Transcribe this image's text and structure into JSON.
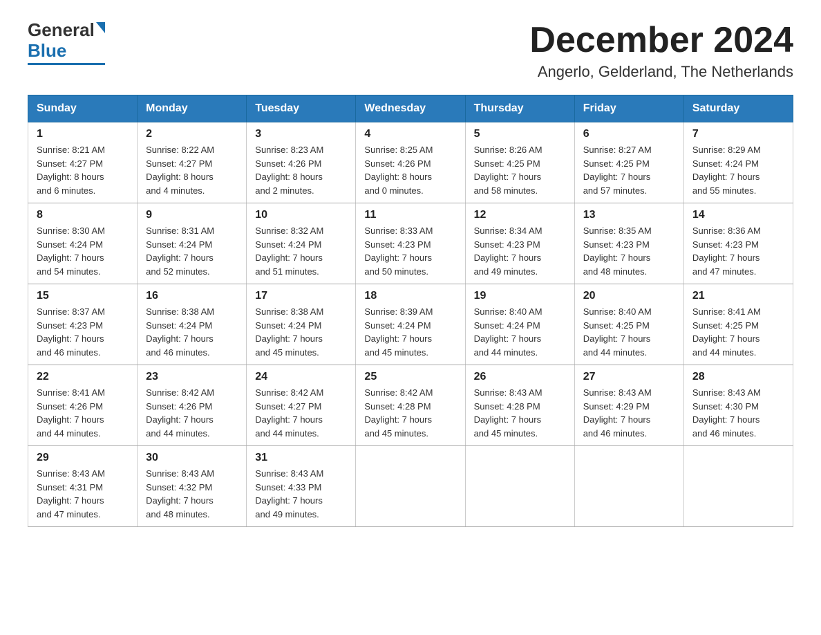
{
  "logo": {
    "text_general": "General",
    "text_blue": "Blue"
  },
  "title": "December 2024",
  "subtitle": "Angerlo, Gelderland, The Netherlands",
  "days_of_week": [
    "Sunday",
    "Monday",
    "Tuesday",
    "Wednesday",
    "Thursday",
    "Friday",
    "Saturday"
  ],
  "weeks": [
    [
      {
        "day": "1",
        "sunrise": "8:21 AM",
        "sunset": "4:27 PM",
        "daylight": "8 hours and 6 minutes."
      },
      {
        "day": "2",
        "sunrise": "8:22 AM",
        "sunset": "4:27 PM",
        "daylight": "8 hours and 4 minutes."
      },
      {
        "day": "3",
        "sunrise": "8:23 AM",
        "sunset": "4:26 PM",
        "daylight": "8 hours and 2 minutes."
      },
      {
        "day": "4",
        "sunrise": "8:25 AM",
        "sunset": "4:26 PM",
        "daylight": "8 hours and 0 minutes."
      },
      {
        "day": "5",
        "sunrise": "8:26 AM",
        "sunset": "4:25 PM",
        "daylight": "7 hours and 58 minutes."
      },
      {
        "day": "6",
        "sunrise": "8:27 AM",
        "sunset": "4:25 PM",
        "daylight": "7 hours and 57 minutes."
      },
      {
        "day": "7",
        "sunrise": "8:29 AM",
        "sunset": "4:24 PM",
        "daylight": "7 hours and 55 minutes."
      }
    ],
    [
      {
        "day": "8",
        "sunrise": "8:30 AM",
        "sunset": "4:24 PM",
        "daylight": "7 hours and 54 minutes."
      },
      {
        "day": "9",
        "sunrise": "8:31 AM",
        "sunset": "4:24 PM",
        "daylight": "7 hours and 52 minutes."
      },
      {
        "day": "10",
        "sunrise": "8:32 AM",
        "sunset": "4:24 PM",
        "daylight": "7 hours and 51 minutes."
      },
      {
        "day": "11",
        "sunrise": "8:33 AM",
        "sunset": "4:23 PM",
        "daylight": "7 hours and 50 minutes."
      },
      {
        "day": "12",
        "sunrise": "8:34 AM",
        "sunset": "4:23 PM",
        "daylight": "7 hours and 49 minutes."
      },
      {
        "day": "13",
        "sunrise": "8:35 AM",
        "sunset": "4:23 PM",
        "daylight": "7 hours and 48 minutes."
      },
      {
        "day": "14",
        "sunrise": "8:36 AM",
        "sunset": "4:23 PM",
        "daylight": "7 hours and 47 minutes."
      }
    ],
    [
      {
        "day": "15",
        "sunrise": "8:37 AM",
        "sunset": "4:23 PM",
        "daylight": "7 hours and 46 minutes."
      },
      {
        "day": "16",
        "sunrise": "8:38 AM",
        "sunset": "4:24 PM",
        "daylight": "7 hours and 46 minutes."
      },
      {
        "day": "17",
        "sunrise": "8:38 AM",
        "sunset": "4:24 PM",
        "daylight": "7 hours and 45 minutes."
      },
      {
        "day": "18",
        "sunrise": "8:39 AM",
        "sunset": "4:24 PM",
        "daylight": "7 hours and 45 minutes."
      },
      {
        "day": "19",
        "sunrise": "8:40 AM",
        "sunset": "4:24 PM",
        "daylight": "7 hours and 44 minutes."
      },
      {
        "day": "20",
        "sunrise": "8:40 AM",
        "sunset": "4:25 PM",
        "daylight": "7 hours and 44 minutes."
      },
      {
        "day": "21",
        "sunrise": "8:41 AM",
        "sunset": "4:25 PM",
        "daylight": "7 hours and 44 minutes."
      }
    ],
    [
      {
        "day": "22",
        "sunrise": "8:41 AM",
        "sunset": "4:26 PM",
        "daylight": "7 hours and 44 minutes."
      },
      {
        "day": "23",
        "sunrise": "8:42 AM",
        "sunset": "4:26 PM",
        "daylight": "7 hours and 44 minutes."
      },
      {
        "day": "24",
        "sunrise": "8:42 AM",
        "sunset": "4:27 PM",
        "daylight": "7 hours and 44 minutes."
      },
      {
        "day": "25",
        "sunrise": "8:42 AM",
        "sunset": "4:28 PM",
        "daylight": "7 hours and 45 minutes."
      },
      {
        "day": "26",
        "sunrise": "8:43 AM",
        "sunset": "4:28 PM",
        "daylight": "7 hours and 45 minutes."
      },
      {
        "day": "27",
        "sunrise": "8:43 AM",
        "sunset": "4:29 PM",
        "daylight": "7 hours and 46 minutes."
      },
      {
        "day": "28",
        "sunrise": "8:43 AM",
        "sunset": "4:30 PM",
        "daylight": "7 hours and 46 minutes."
      }
    ],
    [
      {
        "day": "29",
        "sunrise": "8:43 AM",
        "sunset": "4:31 PM",
        "daylight": "7 hours and 47 minutes."
      },
      {
        "day": "30",
        "sunrise": "8:43 AM",
        "sunset": "4:32 PM",
        "daylight": "7 hours and 48 minutes."
      },
      {
        "day": "31",
        "sunrise": "8:43 AM",
        "sunset": "4:33 PM",
        "daylight": "7 hours and 49 minutes."
      },
      null,
      null,
      null,
      null
    ]
  ]
}
